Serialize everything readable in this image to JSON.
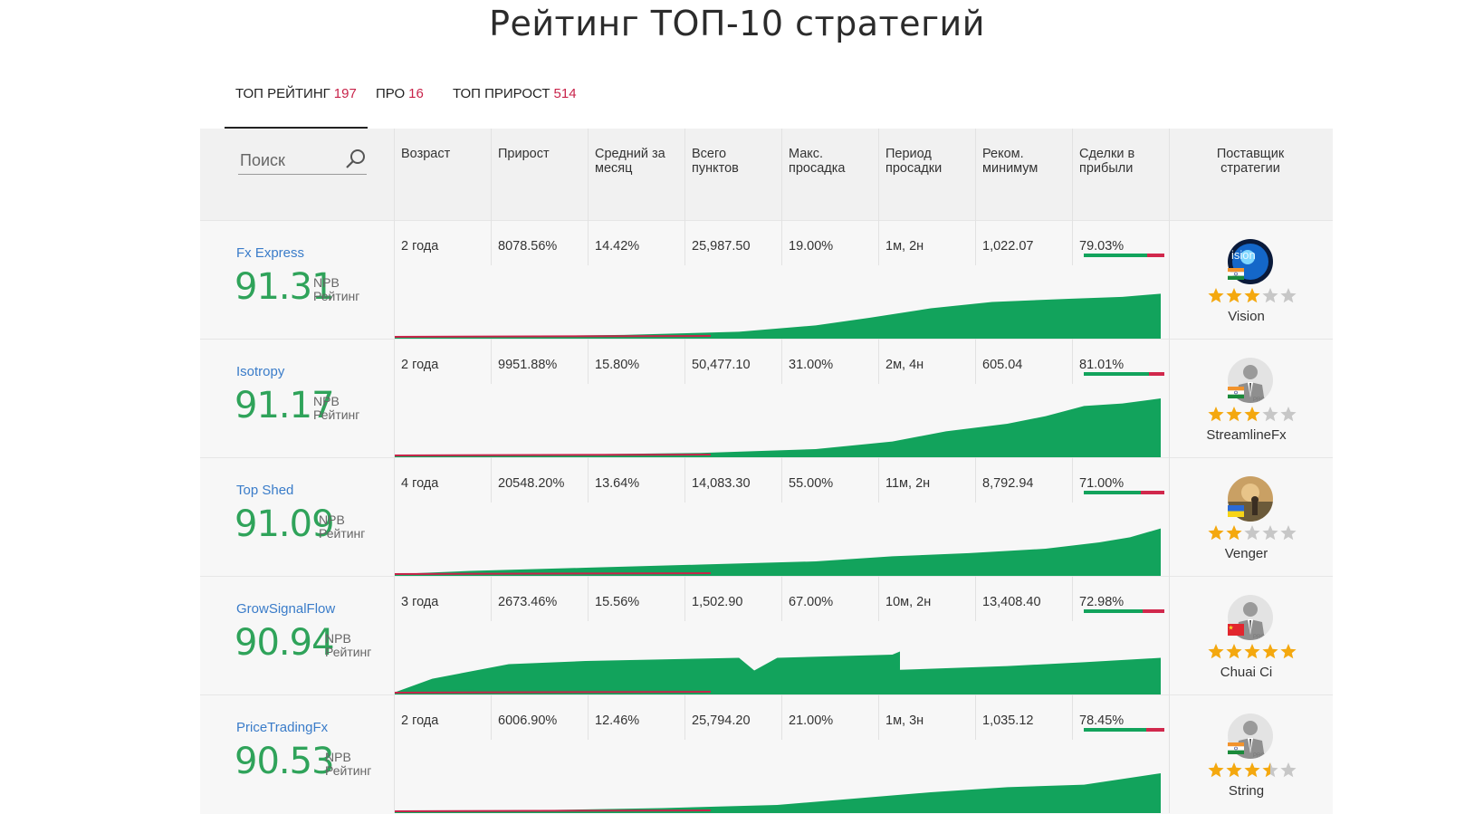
{
  "title": "Рейтинг ТОП-10 стратегий",
  "tabs": [
    {
      "label": "ТОП РЕЙТИНГ",
      "count": "197"
    },
    {
      "label": "ПРО",
      "count": "16"
    },
    {
      "label": "ТОП ПРИРОСТ",
      "count": "514"
    }
  ],
  "search": {
    "placeholder": "Поиск"
  },
  "headers": {
    "age": "Возраст",
    "growth": "Прирост",
    "monthly": "Средний за месяц",
    "points": "Всего пунктов",
    "max_dd": "Макс. просадка",
    "dd_period": "Период просадки",
    "min_deposit": "Реком. минимум",
    "profit_trades": "Сделки в прибыли",
    "provider": "Поставщик стратегии"
  },
  "rating_label": [
    "NPB",
    "Рейтинг"
  ],
  "colors": {
    "accent_green": "#12a35c",
    "score_green": "#2fa35a",
    "link_blue": "#3a7cc9",
    "loss_red": "#d1284c",
    "count_red": "#c8234a"
  },
  "rows": [
    {
      "name": "Fx Express",
      "score": "91.31",
      "age": "2 года",
      "growth": "8078.56%",
      "monthly": "14.42%",
      "points": "25,987.50",
      "max_dd": "19.00%",
      "dd_period": "1м, 2н",
      "min_deposit": "1,022.07",
      "profit_trades": "79.03%",
      "profit_fraction": 0.79,
      "provider": "Vision",
      "stars": 3,
      "flag": "india",
      "avatar": "vision-avatar"
    },
    {
      "name": "Isotropy",
      "score": "91.17",
      "age": "2 года",
      "growth": "9951.88%",
      "monthly": "15.80%",
      "points": "50,477.10",
      "max_dd": "31.00%",
      "dd_period": "2м, 4н",
      "min_deposit": "605.04",
      "profit_trades": "81.01%",
      "profit_fraction": 0.81,
      "provider": "StreamlineFx",
      "stars": 3,
      "flag": "india",
      "avatar": "default-avatar"
    },
    {
      "name": "Top Shed",
      "score": "91.09",
      "age": "4 года",
      "growth": "20548.20%",
      "monthly": "13.64%",
      "points": "14,083.30",
      "max_dd": "55.00%",
      "dd_period": "11м, 2н",
      "min_deposit": "8,792.94",
      "profit_trades": "71.00%",
      "profit_fraction": 0.71,
      "provider": "Venger",
      "stars": 2,
      "flag": "ukraine",
      "avatar": "photo-avatar"
    },
    {
      "name": "GrowSignalFlow",
      "score": "90.94",
      "age": "3 года",
      "growth": "2673.46%",
      "monthly": "15.56%",
      "points": "1,502.90",
      "max_dd": "67.00%",
      "dd_period": "10м, 2н",
      "min_deposit": "13,408.40",
      "profit_trades": "72.98%",
      "profit_fraction": 0.73,
      "provider": "Chuai Ci",
      "stars": 5,
      "flag": "china",
      "avatar": "default-avatar"
    },
    {
      "name": "PriceTradingFx",
      "score": "90.53",
      "age": "2 года",
      "growth": "6006.90%",
      "monthly": "12.46%",
      "points": "25,794.20",
      "max_dd": "21.00%",
      "dd_period": "1м, 3н",
      "min_deposit": "1,035.12",
      "profit_trades": "78.45%",
      "profit_fraction": 0.78,
      "provider": "String",
      "stars": 3.5,
      "flag": "india",
      "avatar": "default-avatar"
    }
  ]
}
